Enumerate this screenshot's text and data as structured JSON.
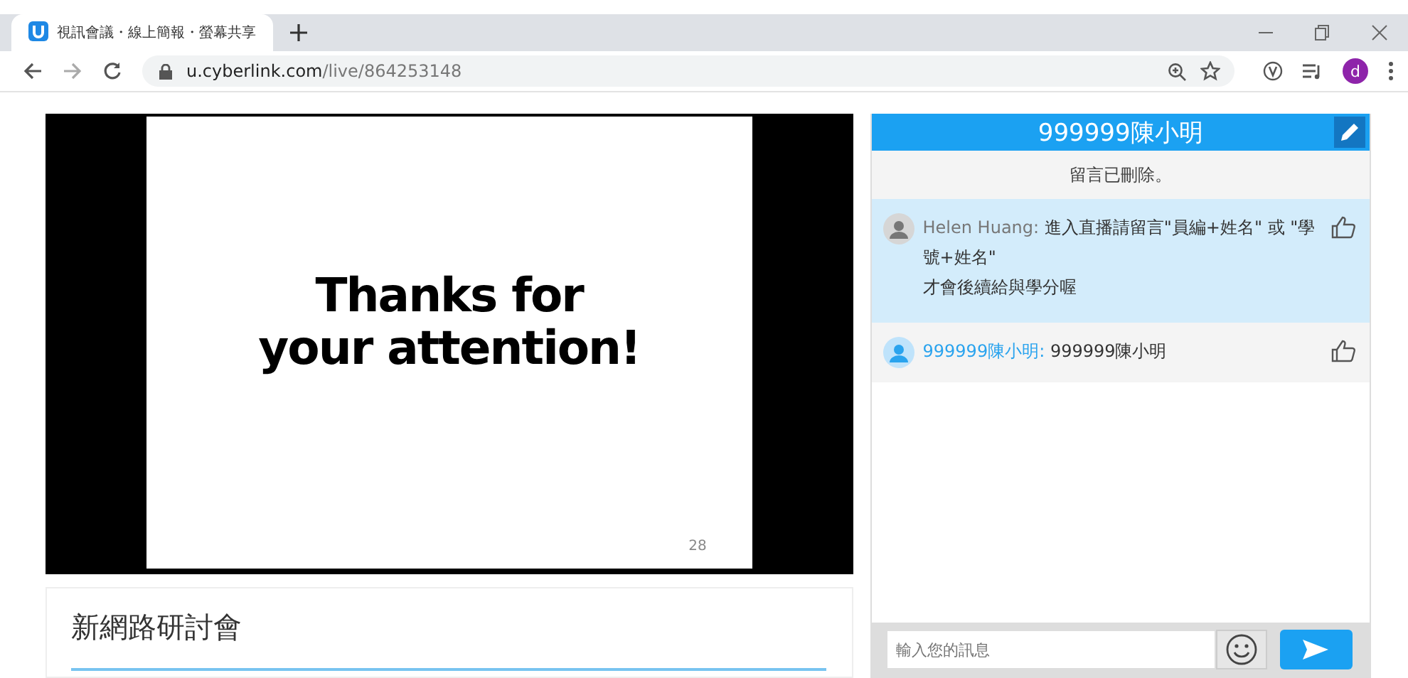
{
  "browser": {
    "tab": {
      "title": "視訊會議・線上簡報・螢幕共享",
      "selected": true
    },
    "url_host": "u.cyberlink.com",
    "url_path": "/live/864253148",
    "profile": "d"
  },
  "video": {
    "slide_lines": [
      "Thanks for",
      "your attention!"
    ],
    "page_number": "28"
  },
  "event": {
    "title": "新網路研討會"
  },
  "chat": {
    "title": "999999陳小明",
    "notice": "留言已刪除。",
    "messages": [
      {
        "author": "Helen Huang:",
        "text": "進入直播請留言\"員編+姓名\" 或 \"學號+姓名\"\n才會後續給與學分喔",
        "own": false,
        "highlighted": true
      },
      {
        "author": "999999陳小明:",
        "text": "999999陳小明",
        "own": true,
        "highlighted": false
      }
    ],
    "input": {
      "placeholder": "輸入您的訊息"
    }
  }
}
